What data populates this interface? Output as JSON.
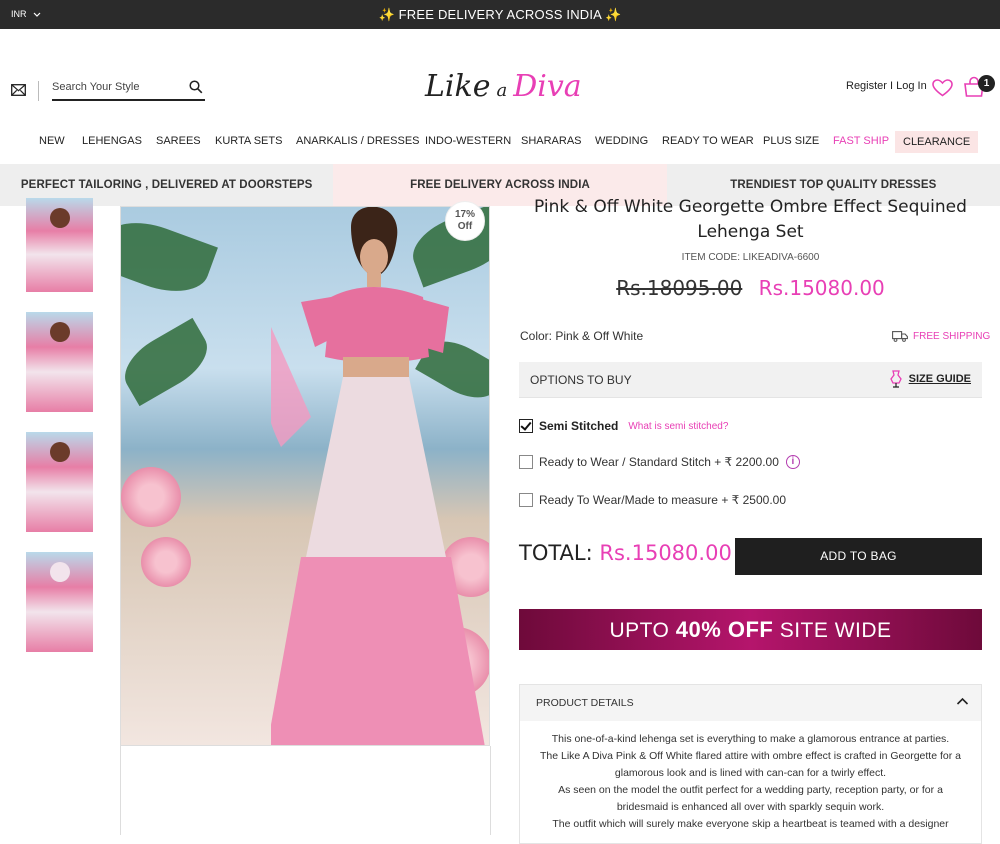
{
  "topbar": {
    "currency": "INR",
    "message": "FREE DELIVERY ACROSS INDIA",
    "spark_left": "✨",
    "spark_right": "✨"
  },
  "header": {
    "search_placeholder": "Search Your Style",
    "logo": {
      "part1": "Like",
      "part2": "a",
      "part3": "Diva"
    },
    "account": "Register I Log In",
    "cart_count": "1"
  },
  "nav": [
    "NEW",
    "LEHENGAS",
    "SAREES",
    "KURTA SETS",
    "ANARKALIS / DRESSES",
    "INDO-WESTERN",
    "SHARARAS",
    "WEDDING",
    "READY TO WEAR",
    "PLUS SIZE",
    "FAST SHIP",
    "CLEARANCE"
  ],
  "strip": [
    "PERFECT TAILORING , DELIVERED AT DOORSTEPS",
    "FREE DELIVERY ACROSS INDIA",
    "TRENDIEST TOP QUALITY DRESSES"
  ],
  "gallery": {
    "discount_pct": "17%",
    "discount_word": "Off"
  },
  "product": {
    "title": "Pink & Off White Georgette Ombre Effect Sequined Lehenga Set",
    "item_code": "ITEM CODE: LIKEADIVA-6600",
    "old_price": "Rs.18095.00",
    "new_price": "Rs.15080.00",
    "color": "Color: Pink & Off White",
    "free_shipping": "FREE SHIPPING",
    "options_title": "OPTIONS TO BUY",
    "size_guide": "SIZE GUIDE",
    "options": [
      {
        "label": "Semi Stitched",
        "checked": true,
        "link": "What is semi stitched?"
      },
      {
        "label": "Ready to Wear / Standard Stitch  + ₹ 2200.00",
        "checked": false
      },
      {
        "label": "Ready To Wear/Made to measure  + ₹ 2500.00",
        "checked": false
      }
    ],
    "total_label": "TOTAL:",
    "total_value": "Rs.15080.00",
    "add_to_bag": "ADD TO BAG",
    "promo": {
      "pre": "UPTO ",
      "bold": "40% OFF",
      "post": " SITE WIDE"
    },
    "details_title": "PRODUCT DETAILS",
    "details_lines": [
      "This one-of-a-kind lehenga set is everything to make a glamorous entrance at parties.",
      "The Like A Diva Pink & Off White flared attire with ombre effect is crafted in Georgette for a glamorous look and is lined with can-can for a twirly effect.",
      "As seen on the model the outfit perfect for a wedding party, reception party, or for a bridesmaid is enhanced all over with sparkly sequin work.",
      "The outfit which will surely make everyone skip a heartbeat is teamed with a designer"
    ]
  },
  "colors": {
    "accent": "#e83fb5",
    "dark": "#1f1f1f",
    "pinkbg": "#fbeaea"
  }
}
